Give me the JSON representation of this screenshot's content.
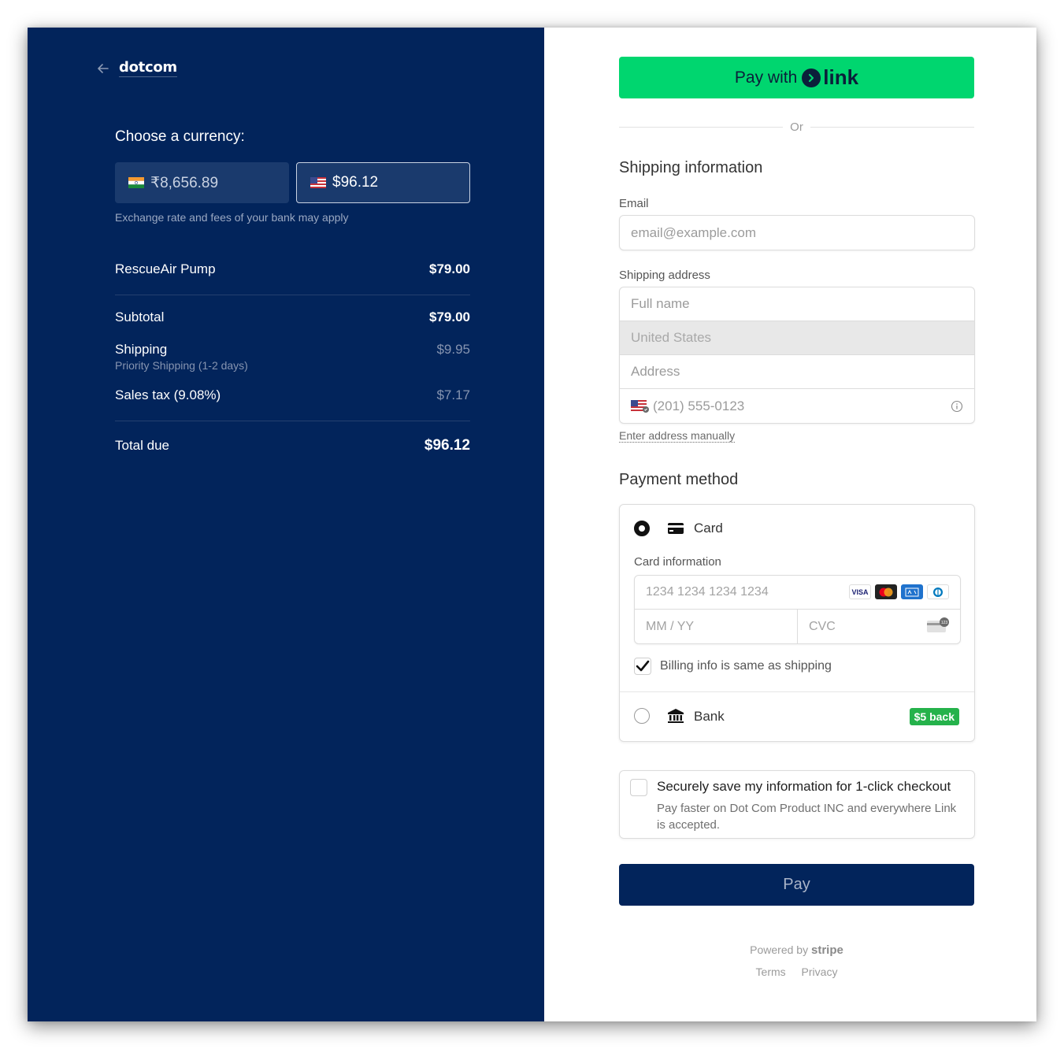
{
  "brand": {
    "name": "dotcom"
  },
  "currency": {
    "title": "Choose a currency:",
    "options": [
      {
        "flag": "india-flag",
        "amount": "₹8,656.89",
        "selected": false
      },
      {
        "flag": "us-flag",
        "amount": "$96.12",
        "selected": true
      }
    ],
    "note": "Exchange rate and fees of your bank may apply"
  },
  "summary": {
    "item": {
      "name": "RescueAir Pump",
      "price": "$79.00"
    },
    "subtotal": {
      "label": "Subtotal",
      "value": "$79.00"
    },
    "shipping": {
      "label": "Shipping",
      "sub": "Priority Shipping (1-2 days)",
      "value": "$9.95"
    },
    "tax": {
      "label": "Sales tax (9.08%)",
      "value": "$7.17"
    },
    "total": {
      "label": "Total due",
      "value": "$96.12"
    }
  },
  "link_button": {
    "prefix": "Pay with",
    "logo": "link"
  },
  "or_text": "Or",
  "shipping_info": {
    "title": "Shipping information",
    "email_label": "Email",
    "email_placeholder": "email@example.com",
    "address_label": "Shipping address",
    "fullname_placeholder": "Full name",
    "country": "United States",
    "address_placeholder": "Address",
    "phone_placeholder": "(201) 555-0123",
    "manual_link": "Enter address manually"
  },
  "payment": {
    "title": "Payment method",
    "card_label": "Card",
    "card_info_label": "Card information",
    "card_number_placeholder": "1234 1234 1234 1234",
    "expiry_placeholder": "MM / YY",
    "cvc_placeholder": "CVC",
    "card_brands": [
      "VISA",
      "mastercard",
      "amex",
      "diners"
    ],
    "billing_same": "Billing info is same as shipping",
    "bank_label": "Bank",
    "bank_badge": "$5 back"
  },
  "save_info": {
    "title": "Securely save my information for 1-click checkout",
    "desc": "Pay faster on Dot Com Product INC and everywhere Link is accepted."
  },
  "pay_button": "Pay",
  "footer": {
    "powered_by": "Powered by",
    "stripe": "stripe",
    "terms": "Terms",
    "privacy": "Privacy"
  },
  "colors": {
    "left_bg": "#02245b",
    "link_green": "#00d66f",
    "pay_button": "#02245b",
    "badge_green": "#25b24b"
  }
}
